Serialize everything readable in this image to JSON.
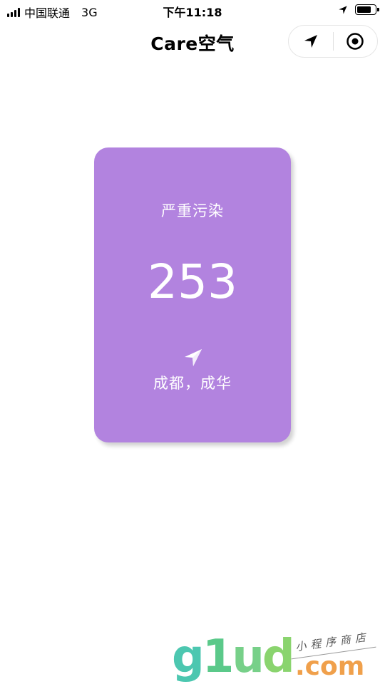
{
  "status_bar": {
    "carrier": "中国联通",
    "network": "3G",
    "time": "下午11:18"
  },
  "nav": {
    "title": "Care空气"
  },
  "aqi_card": {
    "level": "严重污染",
    "value": "253",
    "location": "成都，成华",
    "background_color": "#b283df"
  },
  "watermark": {
    "logo": "g1ud",
    "suffix": ".com",
    "tagline": "小程序商店"
  },
  "icons": {
    "status_location": "location-arrow-icon",
    "nav_location": "navigation-arrow-icon",
    "nav_target": "target-icon",
    "card_location": "location-arrow-icon"
  }
}
